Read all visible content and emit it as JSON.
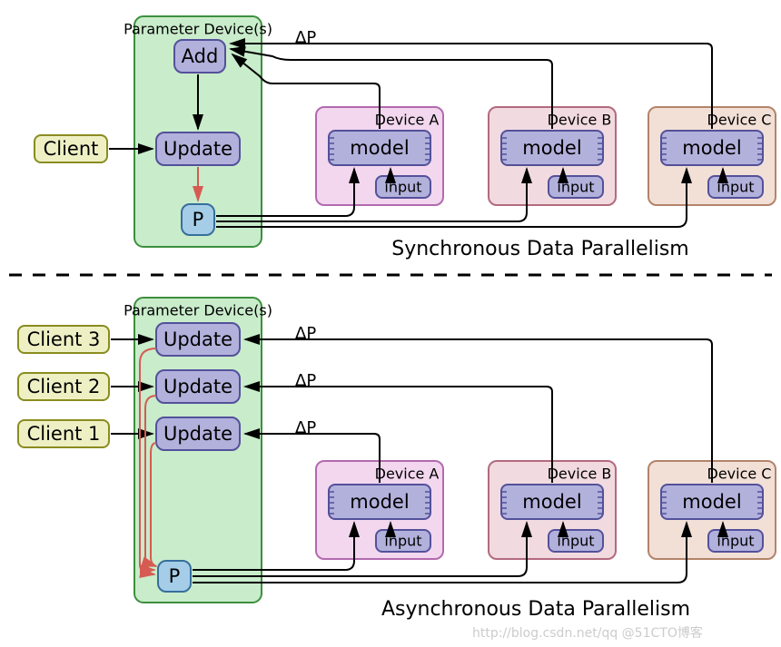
{
  "labels": {
    "paramDevice": "Parameter Device(s)",
    "add": "Add",
    "update": "Update",
    "p": "P",
    "client": "Client",
    "client1": "Client 1",
    "client2": "Client 2",
    "client3": "Client 3",
    "deviceA": "Device A",
    "deviceB": "Device B",
    "deviceC": "Device C",
    "model": "model",
    "input": "input",
    "deltaP": "ΔP",
    "syncTitle": "Synchronous Data Parallelism",
    "asyncTitle": "Asynchronous Data Parallelism",
    "watermark": "http://blog.csdn.net/qq  @51CTO博客"
  },
  "colors": {
    "paramFill": "#c9eccb",
    "paramStroke": "#3c8f3d",
    "nodeFill": "#b2b1dc",
    "nodeStroke": "#53519a",
    "pFill": "#a5cde7",
    "pStroke": "#366f9c",
    "clientFill": "#eef0c4",
    "clientStroke": "#8a8c20",
    "devAFill": "#f2d7ef",
    "devAStroke": "#b36aaf",
    "devBFill": "#f2dbe0",
    "devBStroke": "#b36a7f",
    "devCFill": "#f2e0d7",
    "devCStroke": "#b3846a",
    "arrowBlack": "#000000",
    "arrowRed": "#d65b52"
  }
}
